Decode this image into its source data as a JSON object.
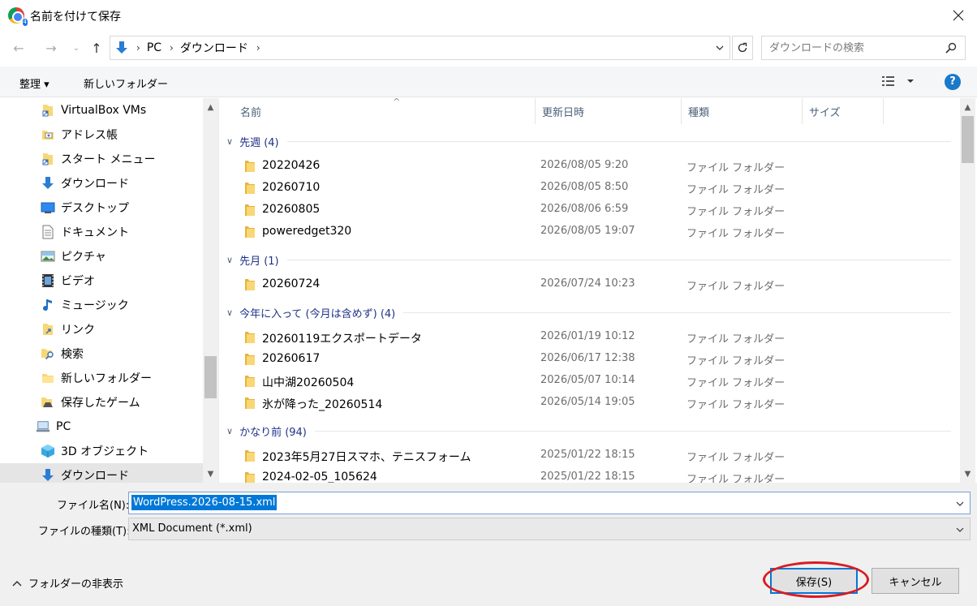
{
  "window": {
    "title": "名前を付けて保存",
    "badge": "4"
  },
  "navbar": {
    "breadcrumbs": [
      "PC",
      "ダウンロード"
    ],
    "search_placeholder": "ダウンロードの検索"
  },
  "toolbar": {
    "organize": "整理 ▾",
    "new_folder": "新しいフォルダー",
    "help": "?"
  },
  "sidebar": {
    "items": [
      {
        "label": "VirtualBox VMs",
        "icon": "folder-shortcut-icon"
      },
      {
        "label": "アドレス帳",
        "icon": "contacts-icon"
      },
      {
        "label": "スタート メニュー",
        "icon": "folder-shortcut-icon"
      },
      {
        "label": "ダウンロード",
        "icon": "download-icon"
      },
      {
        "label": "デスクトップ",
        "icon": "desktop-icon"
      },
      {
        "label": "ドキュメント",
        "icon": "document-icon"
      },
      {
        "label": "ピクチャ",
        "icon": "pictures-icon"
      },
      {
        "label": "ビデオ",
        "icon": "video-icon"
      },
      {
        "label": "ミュージック",
        "icon": "music-icon"
      },
      {
        "label": "リンク",
        "icon": "links-icon"
      },
      {
        "label": "検索",
        "icon": "search-folder-icon"
      },
      {
        "label": "新しいフォルダー",
        "icon": "folder-icon"
      },
      {
        "label": "保存したゲーム",
        "icon": "saved-games-icon"
      },
      {
        "label": "PC",
        "icon": "pc-icon"
      },
      {
        "label": "3D オブジェクト",
        "icon": "3d-objects-icon"
      },
      {
        "label": "ダウンロード",
        "icon": "download-icon",
        "selected": true
      }
    ]
  },
  "columns": {
    "name": "名前",
    "modified": "更新日時",
    "type": "種類",
    "size": "サイズ"
  },
  "groups": [
    {
      "label": "先週 (4)",
      "files": [
        {
          "name": "20220426",
          "date": "2026/08/05 9:20",
          "type": "ファイル フォルダー"
        },
        {
          "name": "20260710",
          "date": "2026/08/05 8:50",
          "type": "ファイル フォルダー"
        },
        {
          "name": "20260805",
          "date": "2026/08/06 6:59",
          "type": "ファイル フォルダー"
        },
        {
          "name": "poweredget320",
          "date": "2026/08/05 19:07",
          "type": "ファイル フォルダー"
        }
      ]
    },
    {
      "label": "先月 (1)",
      "files": [
        {
          "name": "20260724",
          "date": "2026/07/24 10:23",
          "type": "ファイル フォルダー"
        }
      ]
    },
    {
      "label": "今年に入って (今月は含めず) (4)",
      "files": [
        {
          "name": "20260119エクスポートデータ",
          "date": "2026/01/19 10:12",
          "type": "ファイル フォルダー"
        },
        {
          "name": "20260617",
          "date": "2026/06/17 12:38",
          "type": "ファイル フォルダー"
        },
        {
          "name": "山中湖20260504",
          "date": "2026/05/07 10:14",
          "type": "ファイル フォルダー"
        },
        {
          "name": "氷が降った_20260514",
          "date": "2026/05/14 19:05",
          "type": "ファイル フォルダー"
        }
      ]
    },
    {
      "label": "かなり前 (94)",
      "files": [
        {
          "name": "2023年5月27日スマホ、テニスフォーム",
          "date": "2025/01/22 18:15",
          "type": "ファイル フォルダー"
        },
        {
          "name": "2024-02-05_105624",
          "date": "2025/01/22 18:15",
          "type": "ファイル フォルダー"
        }
      ]
    }
  ],
  "form": {
    "filename_label": "ファイル名(N):",
    "filename_value": "WordPress.2026-08-15.xml",
    "filetype_label": "ファイルの種類(T):",
    "filetype_value": "XML Document (*.xml)"
  },
  "footer": {
    "hide_folders": "フォルダーの非表示",
    "save_button": "保存(S)",
    "cancel_button": "キャンセル"
  },
  "colors": {
    "accent": "#0078d7",
    "highlight": "#d81c23",
    "folder": "#f8d775"
  }
}
